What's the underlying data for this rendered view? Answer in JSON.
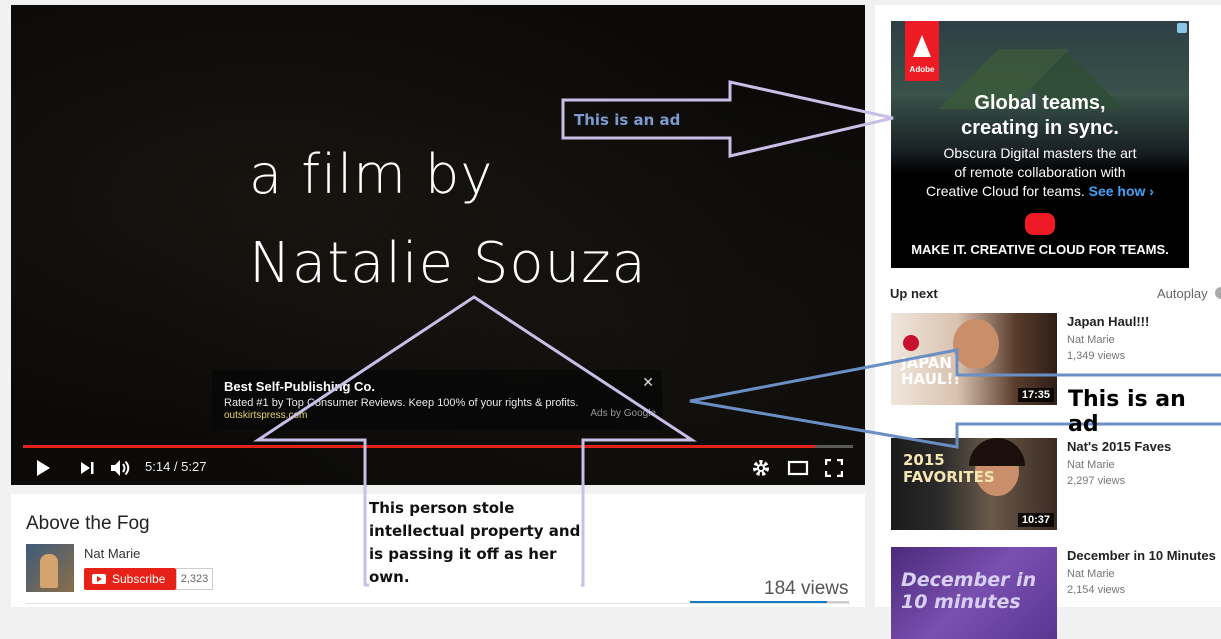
{
  "player": {
    "film_line1": "a film by",
    "film_line2": "Natalie Souza",
    "time": "5:14 / 5:27",
    "progress_fraction": 0.954,
    "overlay_ad": {
      "title": "Best Self-Publishing Co.",
      "description": "Rated #1 by Top Consumer Reviews. Keep 100% of your rights & profits.",
      "url": "outskirtspress.com",
      "attribution": "Ads by Google",
      "close": "✕"
    },
    "icons": [
      "play-icon",
      "next-icon",
      "volume-icon",
      "settings-icon",
      "theater-mode-icon",
      "fullscreen-icon"
    ]
  },
  "video_info": {
    "title": "Above the Fog",
    "channel": "Nat Marie",
    "subscribe_label": "Subscribe",
    "subscriber_count": "2,323",
    "views": "184 views",
    "like_ratio": 0.86
  },
  "banner_ad": {
    "brand": "Adobe",
    "headline_line1": "Global teams,",
    "headline_line2": "creating in sync.",
    "body_line1": "Obscura Digital masters the art",
    "body_line2": "of remote collaboration with",
    "body_line3": "Creative Cloud for teams.",
    "link": "See how ›",
    "footer": "MAKE IT.  CREATIVE CLOUD FOR TEAMS."
  },
  "sidebar": {
    "up_next_label": "Up next",
    "autoplay_label": "Autoplay",
    "items": [
      {
        "title": "Japan Haul!!!",
        "channel": "Nat Marie",
        "views": "1,349 views",
        "duration": "17:35",
        "thumb_text": "JAPAN HAUL!!"
      },
      {
        "title": "Nat's 2015 Faves",
        "channel": "Nat Marie",
        "views": "2,297 views",
        "duration": "10:37",
        "thumb_text": "2015 FAVORITES"
      },
      {
        "title": "December in 10 Minutes",
        "channel": "Nat Marie",
        "views": "2,154 views",
        "duration": "",
        "thumb_text": "December in 10 minutes"
      }
    ]
  },
  "annotations": {
    "ad_note_top": "This is an ad",
    "ad_note_side": "This is an ad",
    "ip_note": "This person stole intellectual property and is passing it off as her own."
  },
  "colors": {
    "accent_red": "#e62117",
    "annotation_stroke": "#c8bfe7",
    "annotation_blue": "#6a8fc5",
    "link_blue": "#167ac6"
  }
}
